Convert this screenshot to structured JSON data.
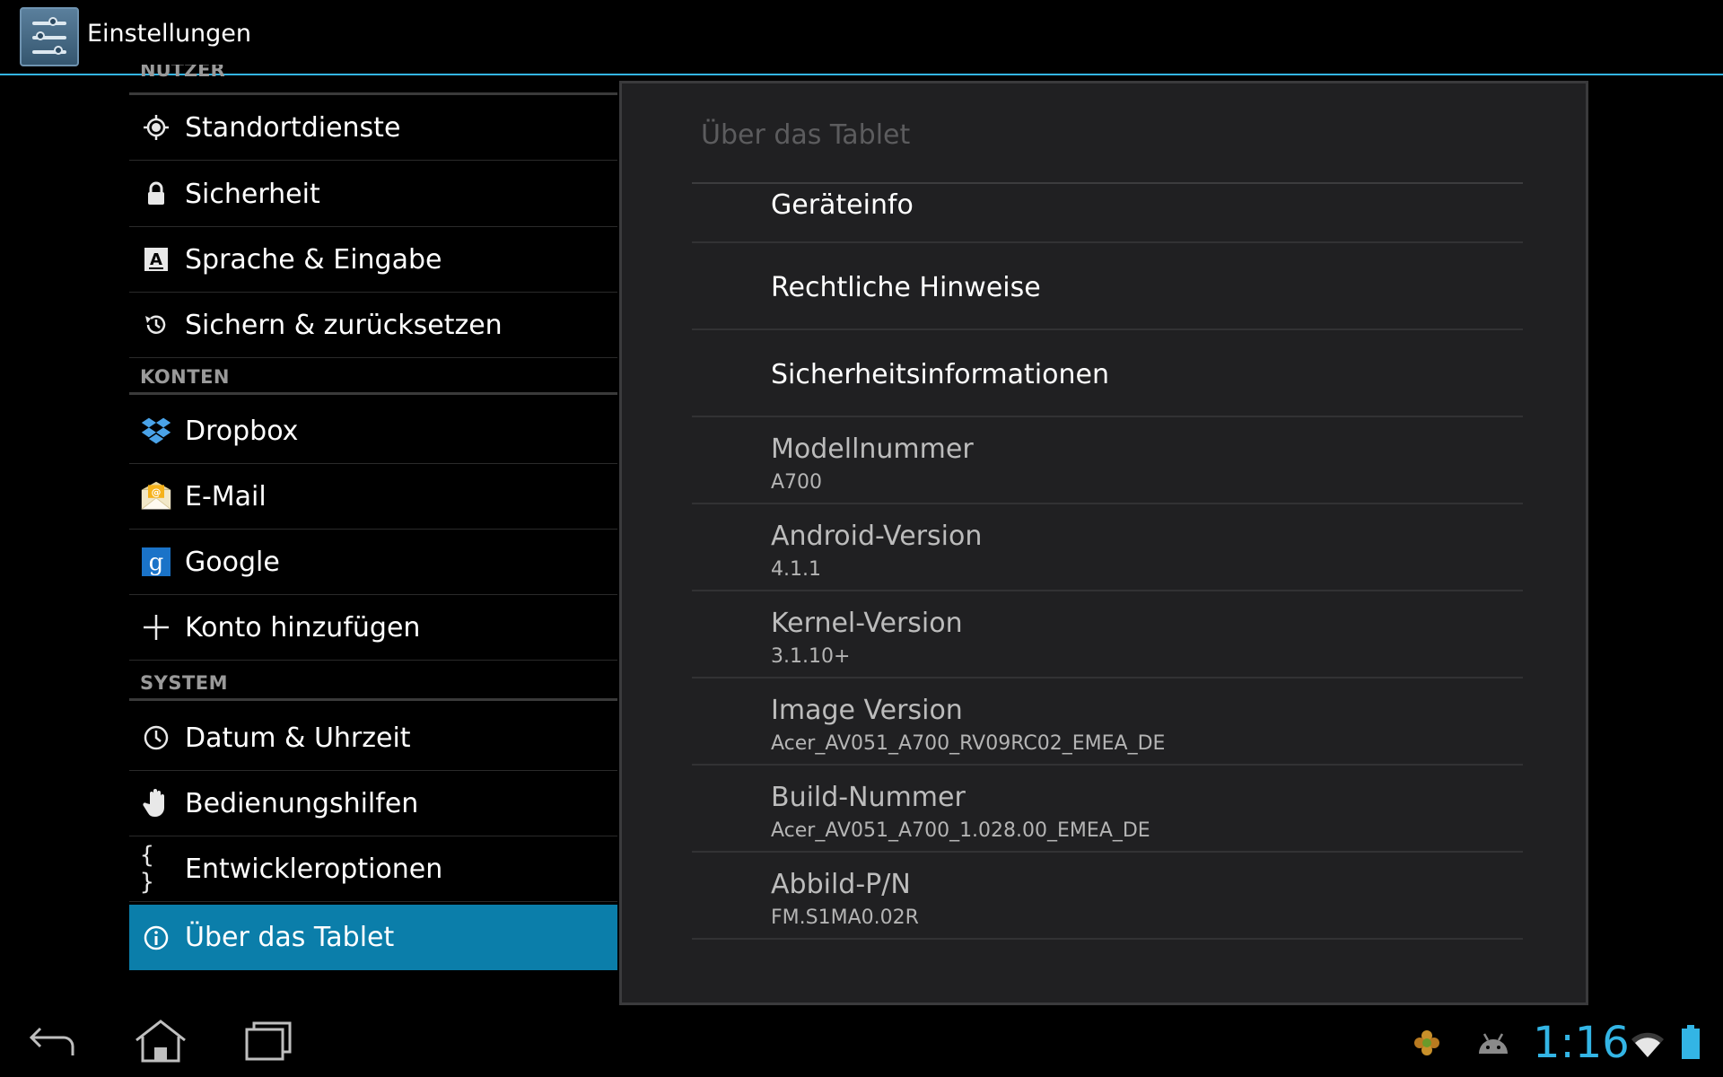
{
  "action_bar": {
    "title": "Einstellungen",
    "icon": "settings-sliders-icon"
  },
  "settings_list": {
    "partial_header": "NUTZER",
    "items_top": [
      {
        "label": "Standortdienste",
        "icon": "location-icon"
      },
      {
        "label": "Sicherheit",
        "icon": "lock-icon"
      },
      {
        "label": "Sprache & Eingabe",
        "icon": "language-icon"
      },
      {
        "label": "Sichern & zurücksetzen",
        "icon": "backup-icon"
      }
    ],
    "accounts_header": "KONTEN",
    "accounts": [
      {
        "label": "Dropbox",
        "icon": "dropbox-icon"
      },
      {
        "label": "E-Mail",
        "icon": "email-icon"
      },
      {
        "label": "Google",
        "icon": "google-icon"
      },
      {
        "label": "Konto hinzufügen",
        "icon": "plus-icon"
      }
    ],
    "system_header": "SYSTEM",
    "system": [
      {
        "label": "Datum & Uhrzeit",
        "icon": "clock-icon"
      },
      {
        "label": "Bedienungshilfen",
        "icon": "hand-icon"
      },
      {
        "label": "Entwickleroptionen",
        "icon": "braces-icon"
      },
      {
        "label": "Über das Tablet",
        "icon": "info-icon",
        "selected": true
      }
    ]
  },
  "detail": {
    "title": "Über das Tablet",
    "actions": [
      {
        "title": "Geräteinfo"
      },
      {
        "title": "Rechtliche Hinweise"
      },
      {
        "title": "Sicherheitsinformationen"
      }
    ],
    "info": [
      {
        "title": "Modellnummer",
        "value": "A700"
      },
      {
        "title": "Android-Version",
        "value": "4.1.1"
      },
      {
        "title": "Kernel-Version",
        "value": "3.1.10+"
      },
      {
        "title": "Image Version",
        "value": "Acer_AV051_A700_RV09RC02_EMEA_DE"
      },
      {
        "title": "Build-Nummer",
        "value": "Acer_AV051_A700_1.028.00_EMEA_DE"
      },
      {
        "title": "Abbild-P/N",
        "value": "FM.S1MA0.02R"
      }
    ]
  },
  "nav_bar": {
    "back_icon": "back-icon",
    "home_icon": "home-icon",
    "recents_icon": "recent-apps-icon"
  },
  "status_bar": {
    "time": "1:16",
    "icons": [
      "notification-flower-icon",
      "android-debug-icon",
      "wifi-icon",
      "battery-icon"
    ]
  },
  "colors": {
    "accent": "#33b5e5",
    "selected_background": "#0b7eaa",
    "panel_background": "#202022"
  }
}
